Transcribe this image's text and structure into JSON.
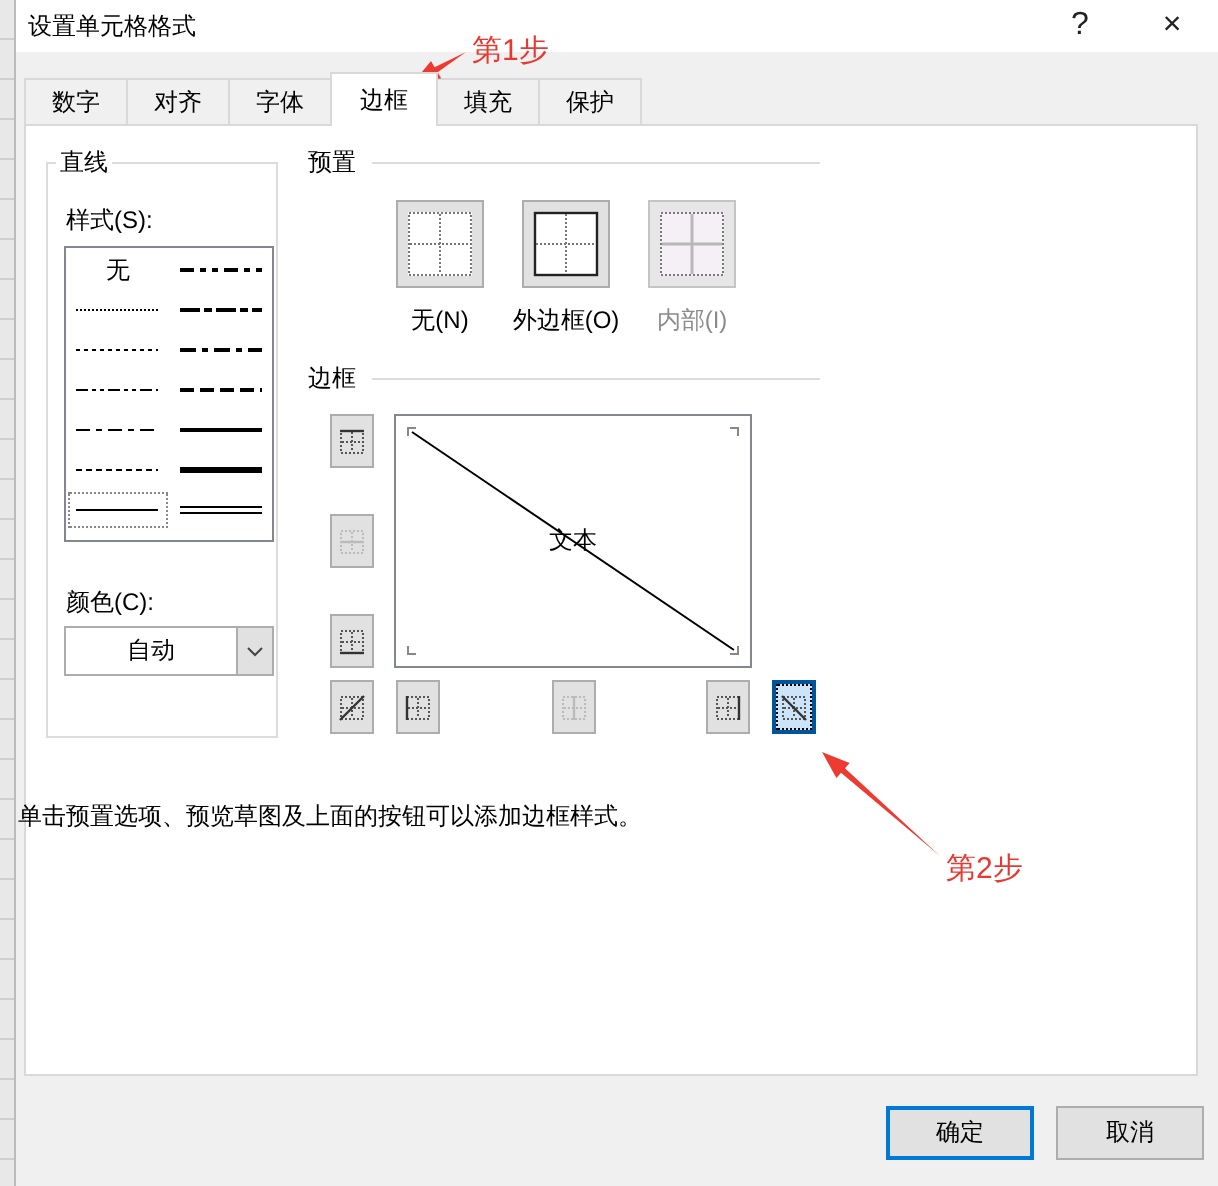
{
  "window": {
    "title": "设置单元格格式",
    "help": "?",
    "close": "×"
  },
  "tabs": [
    {
      "label": "数字",
      "selected": false
    },
    {
      "label": "对齐",
      "selected": false
    },
    {
      "label": "字体",
      "selected": false
    },
    {
      "label": "边框",
      "selected": true
    },
    {
      "label": "填充",
      "selected": false
    },
    {
      "label": "保护",
      "selected": false
    }
  ],
  "line_group": {
    "title": "直线",
    "style_label": "样式(S):",
    "styles": [
      {
        "kind": "none",
        "label": "无",
        "selected": false
      },
      {
        "kind": "dashdotdot-medium",
        "selected": false
      },
      {
        "kind": "hair",
        "selected": false
      },
      {
        "kind": "slant-dashdot",
        "selected": false
      },
      {
        "kind": "dotted",
        "selected": false
      },
      {
        "kind": "dashdot-medium",
        "selected": false
      },
      {
        "kind": "dashdotdot",
        "selected": false
      },
      {
        "kind": "dashed-medium",
        "selected": false
      },
      {
        "kind": "dashdot",
        "selected": false
      },
      {
        "kind": "medium",
        "selected": false
      },
      {
        "kind": "dashed",
        "selected": false
      },
      {
        "kind": "thick",
        "selected": false
      },
      {
        "kind": "thin",
        "selected": true
      },
      {
        "kind": "double",
        "selected": false
      }
    ],
    "color_label": "颜色(C):",
    "color_value": "自动"
  },
  "presets": {
    "title": "预置",
    "items": [
      {
        "kind": "none",
        "label": "无(N)",
        "disabled": false
      },
      {
        "kind": "outline",
        "label": "外边框(O)",
        "disabled": false
      },
      {
        "kind": "inside",
        "label": "内部(I)",
        "disabled": true
      }
    ]
  },
  "border": {
    "title": "边框",
    "preview_text": "文本",
    "buttons": [
      {
        "kind": "top",
        "selected": false,
        "disabled": false
      },
      {
        "kind": "inside-h",
        "selected": false,
        "disabled": true
      },
      {
        "kind": "bottom",
        "selected": false,
        "disabled": false
      },
      {
        "kind": "diag-up",
        "selected": false,
        "disabled": false
      },
      {
        "kind": "left",
        "selected": false,
        "disabled": false
      },
      {
        "kind": "inside-v",
        "selected": false,
        "disabled": true
      },
      {
        "kind": "right",
        "selected": false,
        "disabled": false
      },
      {
        "kind": "diag-down",
        "selected": true,
        "disabled": false
      }
    ]
  },
  "hint": "单击预置选项、预览草图及上面的按钮可以添加边框样式。",
  "buttons": [
    {
      "label": "确定",
      "default": true
    },
    {
      "label": "取消",
      "default": false
    }
  ],
  "annotations": [
    {
      "text": "第1步"
    },
    {
      "text": "第2步"
    }
  ]
}
